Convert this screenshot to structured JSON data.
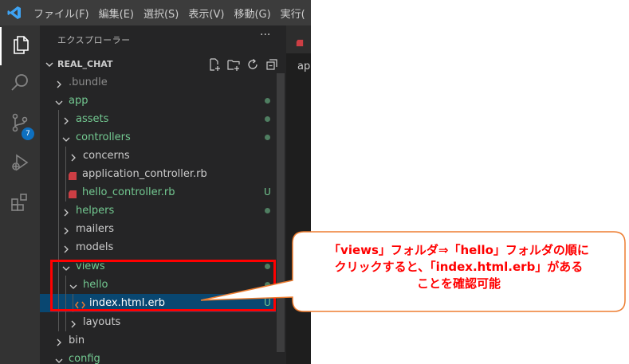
{
  "menu": {
    "items": [
      "ファイル(F)",
      "編集(E)",
      "選択(S)",
      "表示(V)",
      "移動(G)",
      "実行("
    ]
  },
  "activity": {
    "scm_badge": "7"
  },
  "sidebar": {
    "title": "エクスプローラー",
    "more": "···",
    "project": "REAL_CHAT"
  },
  "tree": [
    {
      "label": "bundle_full",
      "text": ".bundle",
      "color": "#8b8b8b"
    },
    {
      "text": "app",
      "color": "#73c991"
    },
    {
      "text": "assets",
      "color": "#73c991"
    },
    {
      "text": "controllers",
      "color": "#73c991"
    },
    {
      "text": "concerns",
      "color": "#cccccc"
    },
    {
      "text": "application_controller.rb",
      "color": "#cccccc"
    },
    {
      "text": "hello_controller.rb",
      "color": "#73c991",
      "status": "U"
    },
    {
      "text": "helpers",
      "color": "#73c991"
    },
    {
      "text": "mailers",
      "color": "#cccccc"
    },
    {
      "text": "models",
      "color": "#cccccc"
    },
    {
      "text": "views",
      "color": "#73c991"
    },
    {
      "text": "hello",
      "color": "#73c991"
    },
    {
      "text": "index.html.erb",
      "color": "#ffffff",
      "status": "U"
    },
    {
      "text": "layouts",
      "color": "#cccccc"
    },
    {
      "text": "bin",
      "color": "#cccccc"
    },
    {
      "text": "config",
      "color": "#73c991"
    }
  ],
  "editor": {
    "partial_text": "ap"
  },
  "callout": {
    "line1": "「views」フォルダ⇒「hello」フォルダの順に",
    "line2": "クリックすると、「index.html.erb」がある",
    "line3": "ことを確認可能"
  },
  "colors": {
    "accent_red": "#ff0000",
    "callout_border": "#ed7d31",
    "selection": "#094771",
    "git_untracked": "#73c991"
  }
}
